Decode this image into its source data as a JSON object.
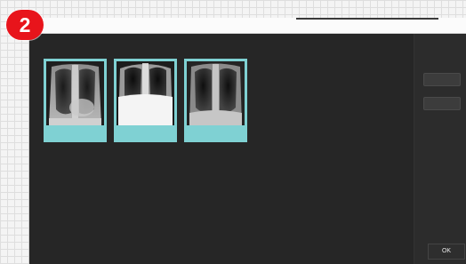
{
  "step_badge": "2",
  "window": {
    "title": "",
    "thumbnails": [
      {
        "caption": "",
        "selected": true,
        "icon": "chest-xray"
      },
      {
        "caption": "",
        "selected": false,
        "icon": "chest-xray"
      },
      {
        "caption": "",
        "selected": false,
        "icon": "chest-xray"
      }
    ],
    "side_buttons": [
      {
        "label": ""
      },
      {
        "label": ""
      }
    ],
    "ok_label": "OK"
  },
  "colors": {
    "badge": "#e8141b",
    "window_bg": "#262626",
    "thumbnail_frame": "#7fd1d3"
  }
}
